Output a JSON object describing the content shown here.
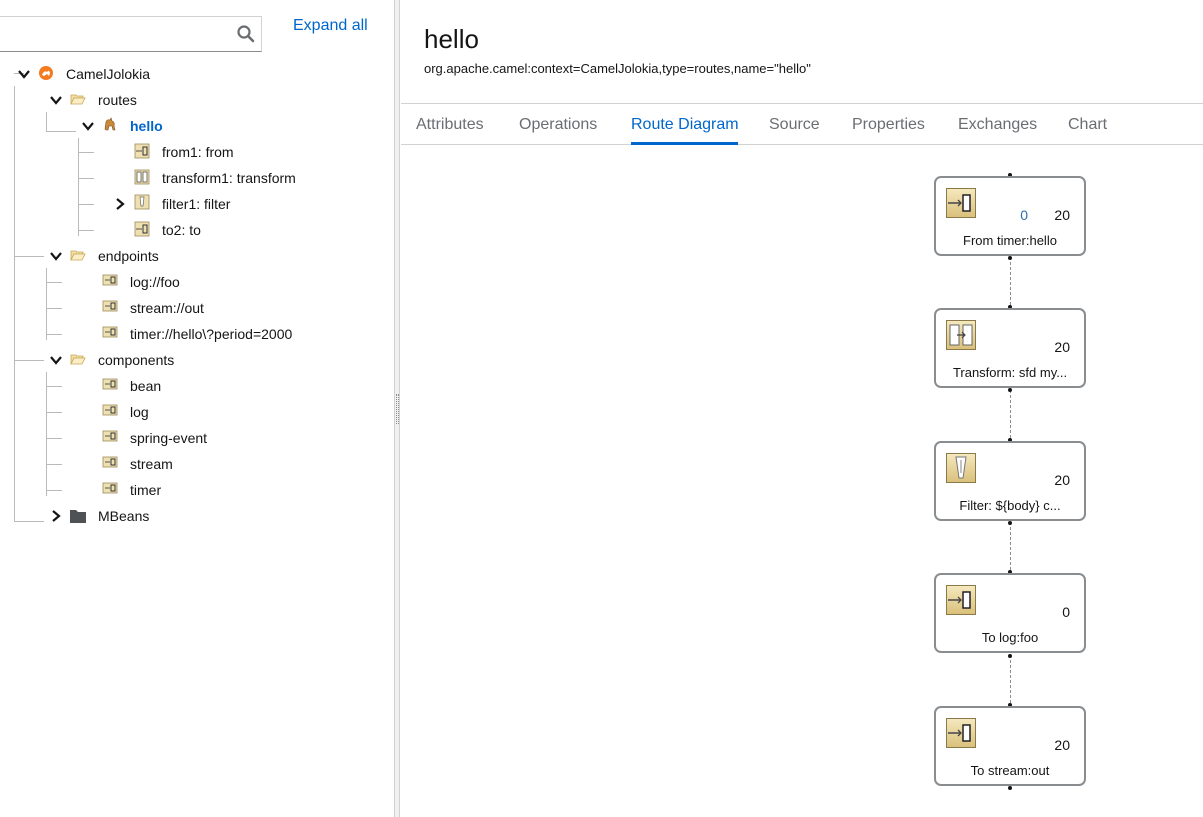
{
  "search": {
    "placeholder": "",
    "value": ""
  },
  "tree_toolbar": {
    "expand_all_label": "Expand all"
  },
  "tree": {
    "camel_context": "CamelJolokia",
    "routes_folder": "routes",
    "route": "hello",
    "route_nodes": [
      "from1: from",
      "transform1: transform",
      "filter1: filter",
      "to2: to"
    ],
    "endpoints_folder": "endpoints",
    "endpoints": [
      "log://foo",
      "stream://out",
      "timer://hello\\?period=2000"
    ],
    "components_folder": "components",
    "components": [
      "bean",
      "log",
      "spring-event",
      "stream",
      "timer"
    ],
    "mbeans_folder": "MBeans"
  },
  "header": {
    "title": "hello",
    "object_name": "org.apache.camel:context=CamelJolokia,type=routes,name=\"hello\""
  },
  "tabs": [
    "Attributes",
    "Operations",
    "Route Diagram",
    "Source",
    "Properties",
    "Exchanges",
    "Chart"
  ],
  "active_tab": "Route Diagram",
  "diagram": {
    "nodes": [
      {
        "label": "From timer:hello",
        "inflight": "0",
        "count": "20",
        "icon": "endpoint-icon"
      },
      {
        "label": "Transform: sfd my...",
        "inflight": "",
        "count": "20",
        "icon": "transform-icon"
      },
      {
        "label": "Filter: ${body} c...",
        "inflight": "",
        "count": "20",
        "icon": "filter-icon"
      },
      {
        "label": "To log:foo",
        "inflight": "",
        "count": "0",
        "icon": "endpoint-icon"
      },
      {
        "label": "To stream:out",
        "inflight": "",
        "count": "20",
        "icon": "endpoint-icon"
      }
    ]
  },
  "colors": {
    "accent": "#0066cc",
    "inflight": "#2f6fb0",
    "icon_fill": "#e2cf94"
  }
}
